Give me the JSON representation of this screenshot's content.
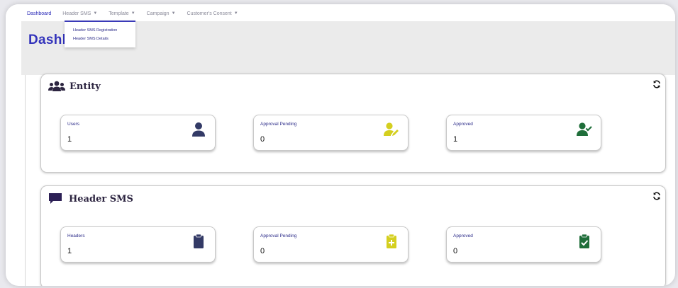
{
  "nav": {
    "items": [
      {
        "label": "Dashboard",
        "caret": false
      },
      {
        "label": "Header SMS",
        "caret": true
      },
      {
        "label": "Template",
        "caret": true
      },
      {
        "label": "Campaign",
        "caret": true
      },
      {
        "label": "Customer's Consent",
        "caret": true
      }
    ],
    "caret_glyph": "▼",
    "dropdown": [
      "Header SMS Registration",
      "Header SMS Details"
    ]
  },
  "page": {
    "title": "Dashb"
  },
  "sections": [
    {
      "title": "Entity",
      "icon": "users-icon",
      "cards": [
        {
          "label": "Users",
          "value": "1",
          "icon": "user-icon",
          "color": "#333a66"
        },
        {
          "label": "Approval Pending",
          "value": "0",
          "icon": "user-edit-icon",
          "color": "#d4cf1f"
        },
        {
          "label": "Approved",
          "value": "1",
          "icon": "user-check-icon",
          "color": "#1f6e3a"
        }
      ]
    },
    {
      "title": "Header SMS",
      "icon": "message-icon",
      "cards": [
        {
          "label": "Headers",
          "value": "1",
          "icon": "clipboard-icon",
          "color": "#333a66"
        },
        {
          "label": "Approval Pending",
          "value": "0",
          "icon": "clipboard-plus-icon",
          "color": "#d4cf1f"
        },
        {
          "label": "Approved",
          "value": "0",
          "icon": "clipboard-check-icon",
          "color": "#1f6e3a"
        }
      ]
    }
  ],
  "colors": {
    "accent": "#3333bb",
    "section_title": "#2c2440",
    "nav_text": "#8a8a99"
  }
}
